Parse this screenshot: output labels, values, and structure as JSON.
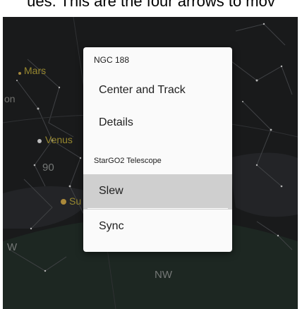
{
  "caption": "ues. This are the four arrows to mov",
  "sky": {
    "planets": [
      "Mars",
      "Venus",
      "Su"
    ],
    "grid_label": "90",
    "constellation_fragment": "on",
    "compass": {
      "west": "W",
      "northwest": "NW"
    }
  },
  "menu": {
    "object_header": "NGC 188",
    "object_actions": [
      "Center and Track",
      "Details"
    ],
    "telescope_header": "StarGO2 Telescope",
    "telescope_actions": [
      "Slew",
      "Sync"
    ],
    "selected_action": "Slew"
  },
  "colors": {
    "sky_background": "#1f2022",
    "horizon_ground": "#24302a",
    "planet_label": "#b8a53a",
    "menu_background": "#fafafa",
    "menu_selected": "#cfcfcf"
  }
}
